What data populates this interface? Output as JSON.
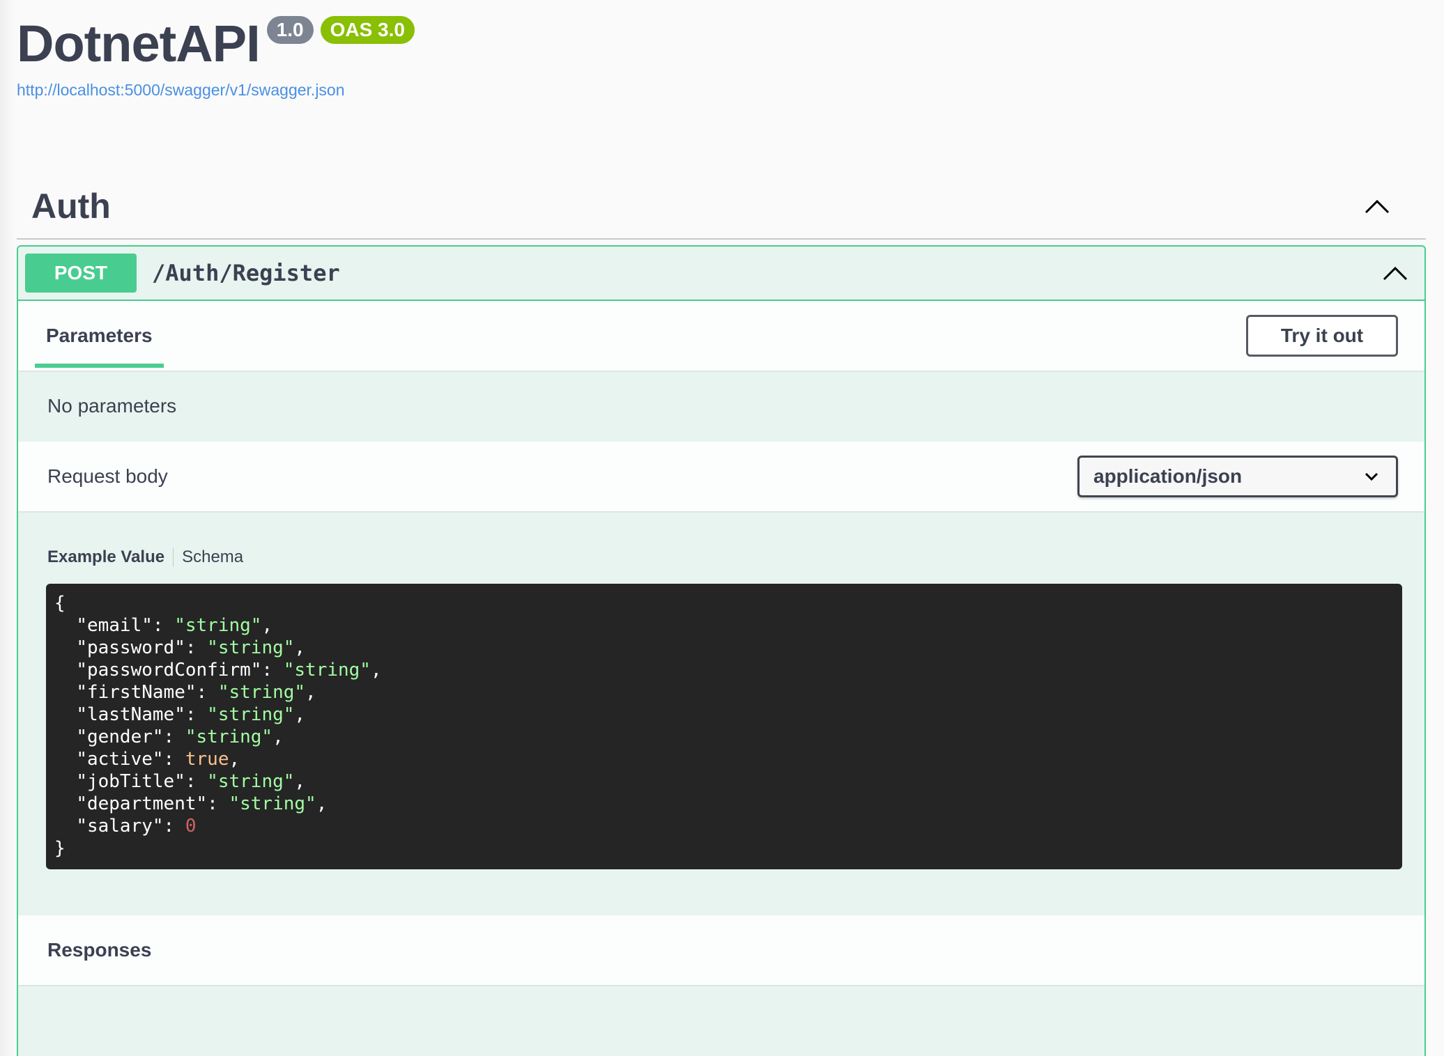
{
  "info": {
    "title": "DotnetAPI",
    "version": "1.0",
    "oas": "OAS 3.0",
    "spec_url": "http://localhost:5000/swagger/v1/swagger.json"
  },
  "tag": {
    "name": "Auth",
    "icon": "chevron-up-icon"
  },
  "operation": {
    "method": "POST",
    "path": "/Auth/Register",
    "method_color": "#49cc90",
    "parameters_tab": "Parameters",
    "try_button": "Try it out",
    "no_params": "No parameters",
    "request_body_label": "Request body",
    "content_type": "application/json",
    "example_tab": "Example Value",
    "schema_tab": "Schema",
    "responses_label": "Responses"
  },
  "example": {
    "open": "{",
    "close": "}",
    "fields": [
      {
        "key": "\"email\"",
        "value": "\"string\"",
        "type": "str",
        "comma": ","
      },
      {
        "key": "\"password\"",
        "value": "\"string\"",
        "type": "str",
        "comma": ","
      },
      {
        "key": "\"passwordConfirm\"",
        "value": "\"string\"",
        "type": "str",
        "comma": ","
      },
      {
        "key": "\"firstName\"",
        "value": "\"string\"",
        "type": "str",
        "comma": ","
      },
      {
        "key": "\"lastName\"",
        "value": "\"string\"",
        "type": "str",
        "comma": ","
      },
      {
        "key": "\"gender\"",
        "value": "\"string\"",
        "type": "str",
        "comma": ","
      },
      {
        "key": "\"active\"",
        "value": "true",
        "type": "bool",
        "comma": ","
      },
      {
        "key": "\"jobTitle\"",
        "value": "\"string\"",
        "type": "str",
        "comma": ","
      },
      {
        "key": "\"department\"",
        "value": "\"string\"",
        "type": "str",
        "comma": ","
      },
      {
        "key": "\"salary\"",
        "value": "0",
        "type": "num",
        "comma": ""
      }
    ]
  },
  "colors": {
    "post_green": "#49cc90",
    "link_blue": "#4990e2",
    "version_badge": "#7d8492",
    "oas_badge": "#89bf04",
    "code_bg": "#252525"
  }
}
